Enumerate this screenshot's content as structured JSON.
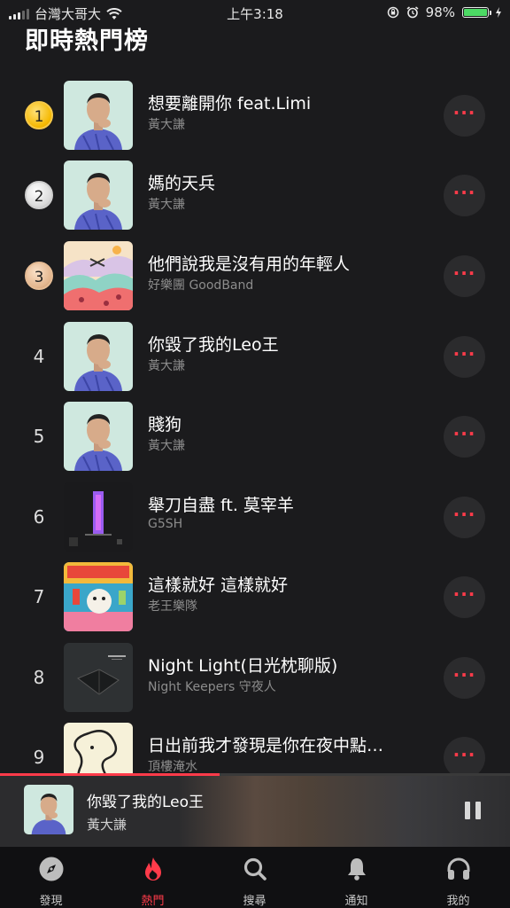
{
  "status_bar": {
    "carrier": "台灣大哥大",
    "time": "上午3:18",
    "battery": "98%"
  },
  "page_title": "即時熱門榜",
  "songs": [
    {
      "rank": "1",
      "title": "想要離開你 feat.Limi",
      "artist": "黃大謙"
    },
    {
      "rank": "2",
      "title": "媽的天兵",
      "artist": "黃大謙"
    },
    {
      "rank": "3",
      "title": "他們說我是沒有用的年輕人",
      "artist": "好樂團 GoodBand"
    },
    {
      "rank": "4",
      "title": "你毀了我的Leo王",
      "artist": "黃大謙"
    },
    {
      "rank": "5",
      "title": "賤狗",
      "artist": "黃大謙"
    },
    {
      "rank": "6",
      "title": "舉刀自盡 ft. 莫宰羊",
      "artist": "G5SH"
    },
    {
      "rank": "7",
      "title": "這樣就好 這樣就好",
      "artist": "老王樂隊"
    },
    {
      "rank": "8",
      "title": "Night Light(日光枕聊版)",
      "artist": "Night Keepers 守夜人"
    },
    {
      "rank": "9",
      "title": "日出前我才發現是你在夜中點…",
      "artist": "頂樓淹水"
    }
  ],
  "more_label": "···",
  "now_playing": {
    "title": "你毀了我的Leo王",
    "artist": "黃大謙",
    "progress": 0.43
  },
  "tabs": [
    {
      "label": "發現",
      "icon": "compass-icon",
      "active": false
    },
    {
      "label": "熱門",
      "icon": "flame-icon",
      "active": true
    },
    {
      "label": "搜尋",
      "icon": "search-icon",
      "active": false
    },
    {
      "label": "通知",
      "icon": "bell-icon",
      "active": false
    },
    {
      "label": "我的",
      "icon": "headphones-icon",
      "active": false
    }
  ],
  "colors": {
    "accent": "#ff3b4a",
    "background": "#1b1b1d",
    "battery": "#4cd964"
  }
}
